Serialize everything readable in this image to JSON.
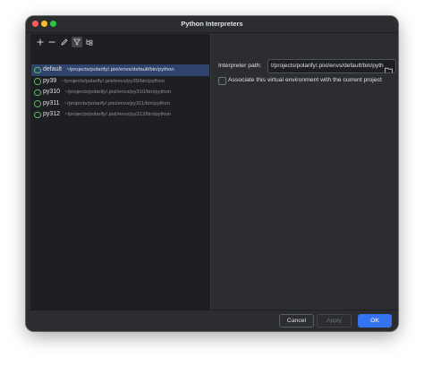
{
  "window": {
    "title": "Python Interpreters"
  },
  "toolbar": {
    "add_icon": "plus-icon",
    "remove_icon": "minus-icon",
    "edit_icon": "pencil-icon",
    "filter_icon": "filter-icon",
    "tree_icon": "tree-icon"
  },
  "interpreters": [
    {
      "name": "default",
      "path": "~/projects/polarify/.pixi/envs/default/bin/python",
      "selected": true
    },
    {
      "name": "py39",
      "path": "~/projects/polarify/.pixi/envs/py39/bin/python",
      "selected": false
    },
    {
      "name": "py310",
      "path": "~/projects/polarify/.pixi/envs/py310/bin/python",
      "selected": false
    },
    {
      "name": "py311",
      "path": "~/projects/polarify/.pixi/envs/py311/bin/python",
      "selected": false
    },
    {
      "name": "py312",
      "path": "~/projects/polarify/.pixi/envs/py312/bin/python",
      "selected": false
    }
  ],
  "details": {
    "interpreter_path_label": "Interpreter path:",
    "interpreter_path_value": "t/projects/polarify/.pixi/envs/default/bin/python",
    "associate_label": "Associate this virtual environment with the current project",
    "associate_checked": false
  },
  "footer": {
    "cancel_label": "Cancel",
    "apply_label": "Apply",
    "ok_label": "OK"
  },
  "colors": {
    "accent": "#3574f0",
    "selection": "#2e436e",
    "interpreter_icon": "#5fb85f"
  }
}
